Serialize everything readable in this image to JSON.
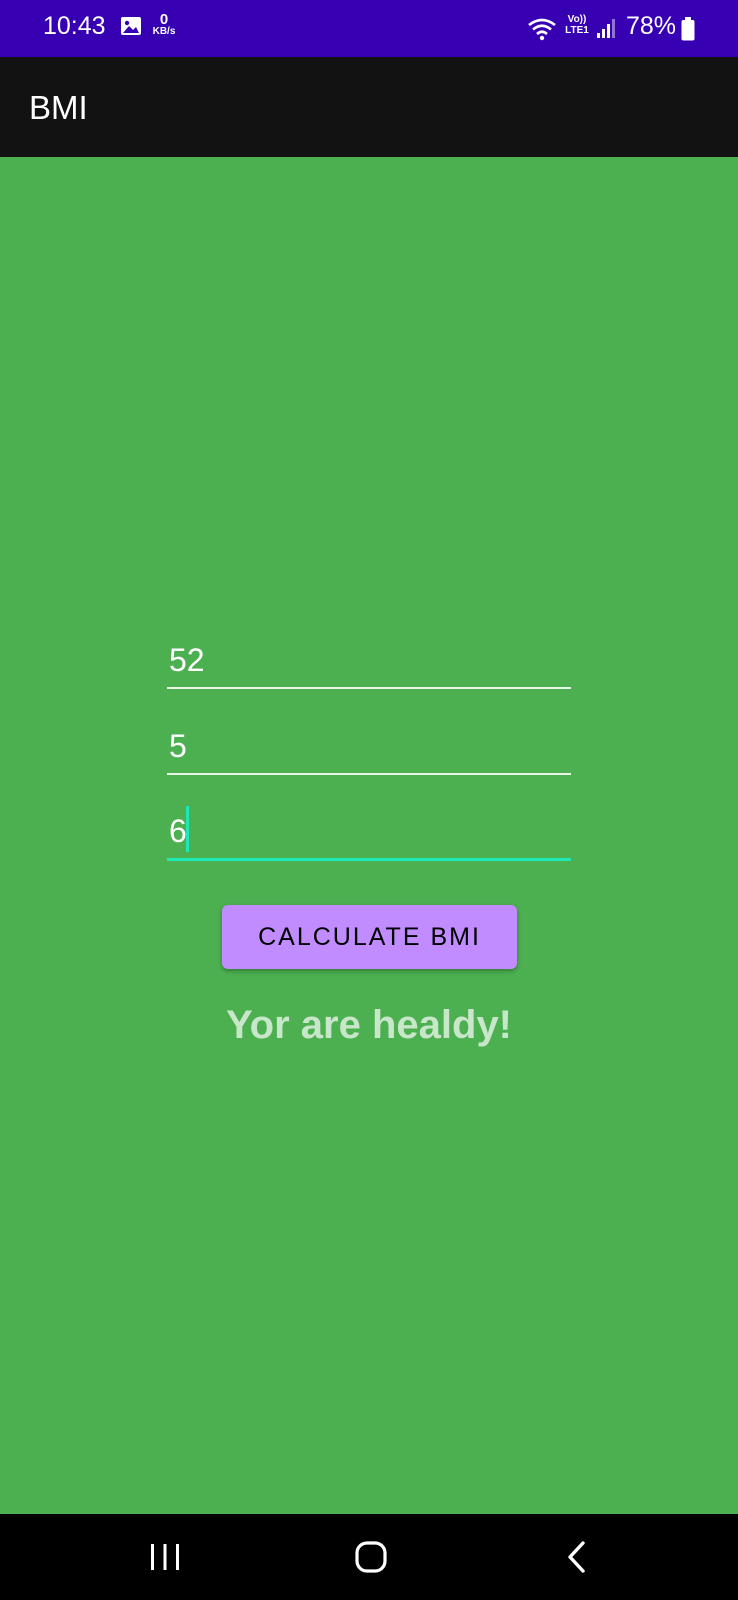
{
  "status_bar": {
    "time": "10:43",
    "net_speed_value": "0",
    "net_speed_unit": "KB/s",
    "lte_top": "Vo))",
    "lte_bottom": "LTE1",
    "battery": "78%",
    "icons": [
      "gallery-icon",
      "wifi-icon",
      "signal-icon",
      "battery-icon"
    ]
  },
  "app_bar": {
    "title": "BMI"
  },
  "form": {
    "weight_value": "52",
    "height_feet_value": "5",
    "height_inches_value": "6",
    "button_label": "CALCULATE BMI",
    "result": "Yor are healdy!"
  },
  "nav_bar": {
    "icons": [
      "recent-apps-icon",
      "home-icon",
      "back-icon"
    ]
  },
  "colors": {
    "status_bar": "#3700b3",
    "app_bar": "#121212",
    "background": "#4caf50",
    "button": "#c18cff",
    "accent": "#1de9b6",
    "result_text": "#c8e6c9"
  }
}
